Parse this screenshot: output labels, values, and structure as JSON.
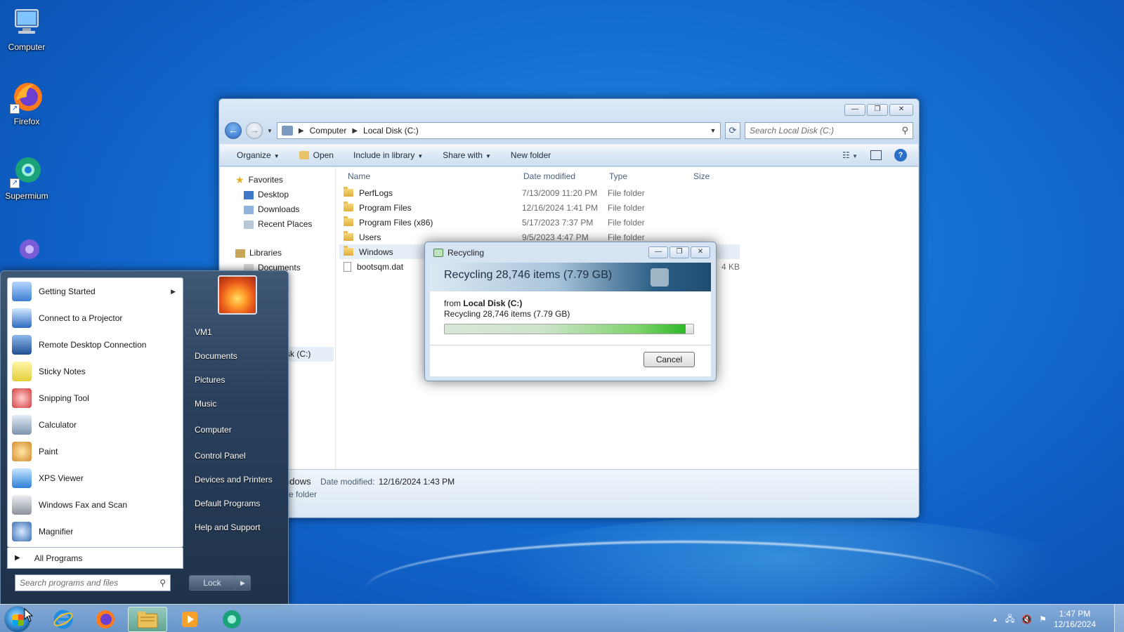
{
  "desktop": {
    "icons": [
      {
        "label": "Computer",
        "icon": "computer-icon"
      },
      {
        "label": "Firefox",
        "icon": "firefox-icon"
      },
      {
        "label": "Supermium",
        "icon": "supermium-icon"
      }
    ]
  },
  "explorer": {
    "breadcrumb": [
      "Computer",
      "Local Disk (C:)"
    ],
    "search_placeholder": "Search Local Disk (C:)",
    "commands": [
      "Organize",
      "Open",
      "Include in library",
      "Share with",
      "New folder"
    ],
    "nav": {
      "favorites": "Favorites",
      "favorites_items": [
        "Desktop",
        "Downloads",
        "Recent Places"
      ],
      "libraries": "Libraries",
      "libraries_items": [
        "Documents"
      ],
      "selected_drive_fragment": "sk (C:)"
    },
    "columns": [
      "Name",
      "Date modified",
      "Type",
      "Size"
    ],
    "rows": [
      {
        "name": "PerfLogs",
        "date": "7/13/2009 11:20 PM",
        "type": "File folder",
        "size": ""
      },
      {
        "name": "Program Files",
        "date": "12/16/2024 1:41 PM",
        "type": "File folder",
        "size": ""
      },
      {
        "name": "Program Files (x86)",
        "date": "5/17/2023 7:37 PM",
        "type": "File folder",
        "size": ""
      },
      {
        "name": "Users",
        "date": "9/5/2023 4:47 PM",
        "type": "File folder",
        "size": ""
      },
      {
        "name": "Windows",
        "date": "",
        "type": "",
        "size": ""
      },
      {
        "name": "bootsqm.dat",
        "date": "",
        "type": "",
        "size": "4 KB"
      }
    ],
    "details": {
      "name_fragment": "ndows",
      "date_label": "Date modified:",
      "date_value": "12/16/2024 1:43 PM",
      "type_fragment": "e folder"
    }
  },
  "dialog": {
    "title": "Recycling",
    "header": "Recycling 28,746 items (7.79 GB)",
    "from_label": "from",
    "from_value": "Local Disk (C:)",
    "status": "Recycling 28,746 items (7.79 GB)",
    "progress_fraction": 0.97,
    "cancel": "Cancel"
  },
  "start_menu": {
    "programs": [
      {
        "label": "Getting Started",
        "icon": "getting-started-icon",
        "has_submenu": true
      },
      {
        "label": "Connect to a Projector",
        "icon": "projector-icon"
      },
      {
        "label": "Remote Desktop Connection",
        "icon": "remote-desktop-icon"
      },
      {
        "label": "Sticky Notes",
        "icon": "sticky-notes-icon"
      },
      {
        "label": "Snipping Tool",
        "icon": "snipping-tool-icon"
      },
      {
        "label": "Calculator",
        "icon": "calculator-icon"
      },
      {
        "label": "Paint",
        "icon": "paint-icon"
      },
      {
        "label": "XPS Viewer",
        "icon": "xps-viewer-icon"
      },
      {
        "label": "Windows Fax and Scan",
        "icon": "fax-scan-icon"
      },
      {
        "label": "Magnifier",
        "icon": "magnifier-icon"
      }
    ],
    "all_programs": "All Programs",
    "search_placeholder": "Search programs and files",
    "right_items": [
      "VM1",
      "Documents",
      "Pictures",
      "Music",
      "Computer",
      "Control Panel",
      "Devices and Printers",
      "Default Programs",
      "Help and Support"
    ],
    "lock": "Lock"
  },
  "taskbar": {
    "items": [
      "internet-explorer-icon",
      "firefox-icon",
      "windows-explorer-icon",
      "media-player-icon",
      "supermium-icon"
    ],
    "clock_time": "1:47 PM",
    "clock_date": "12/16/2024"
  }
}
